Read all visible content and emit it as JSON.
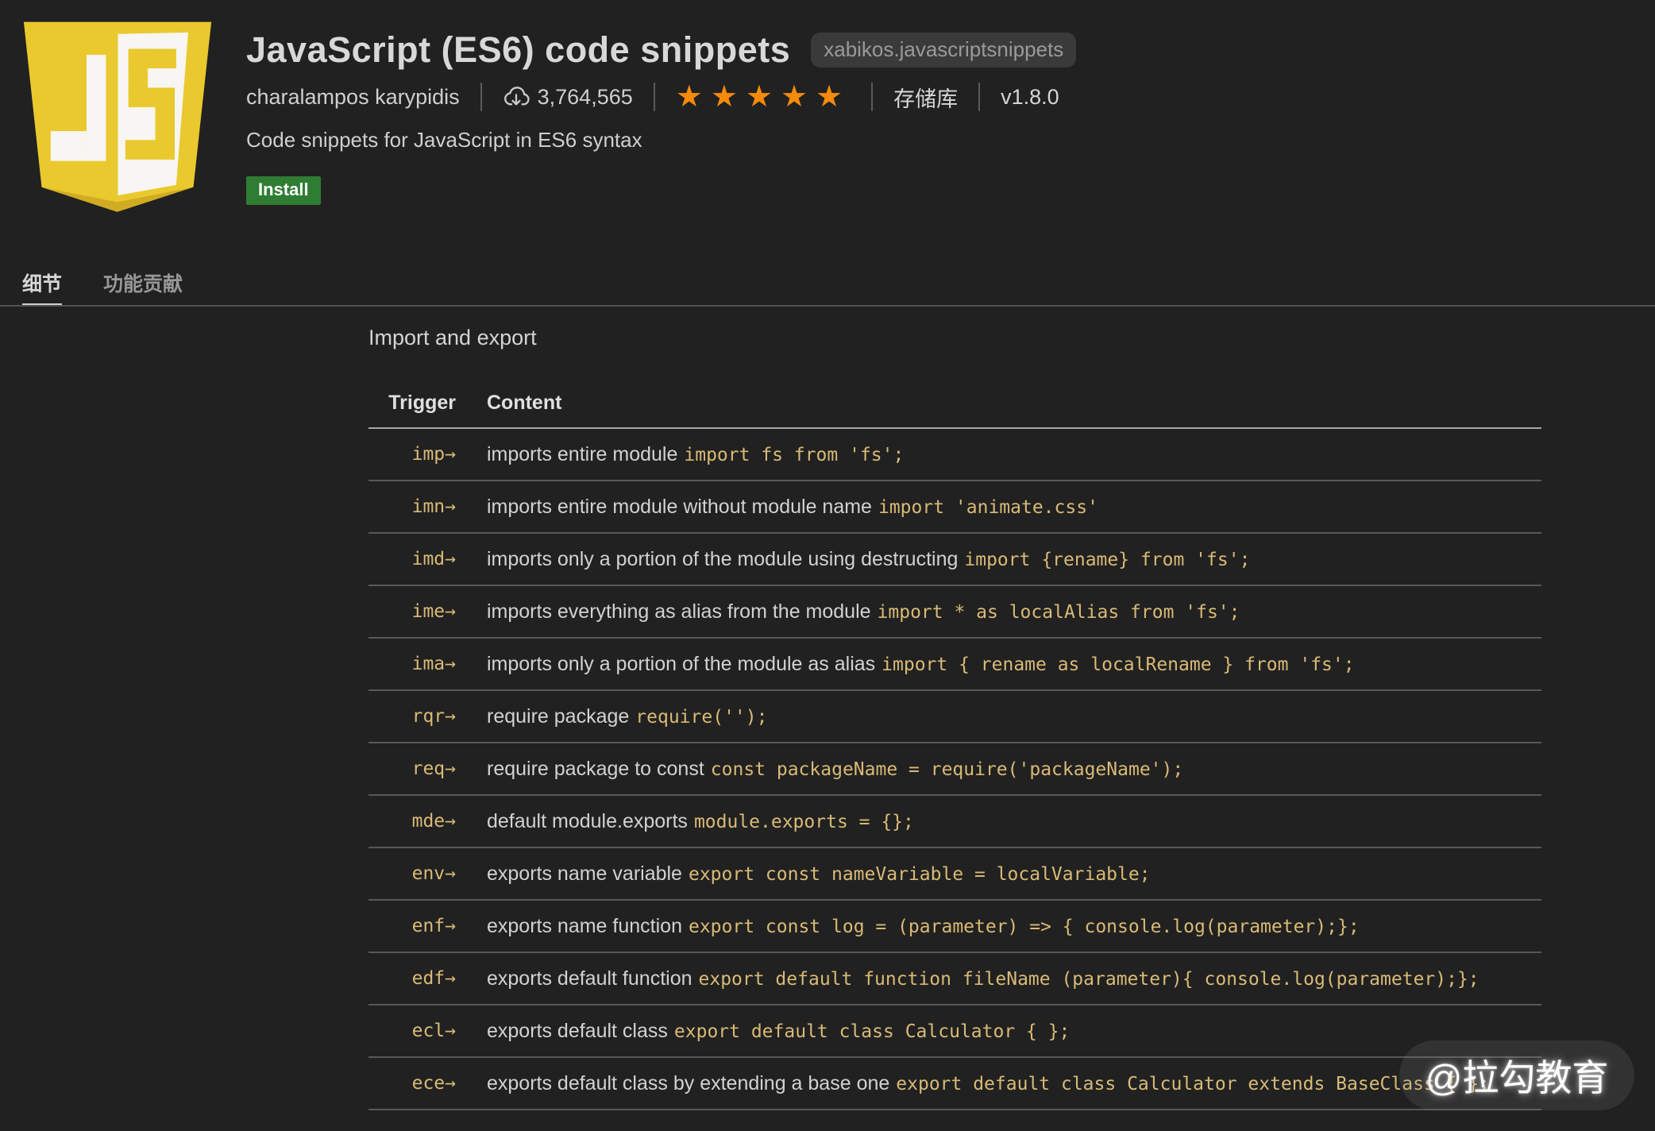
{
  "header": {
    "title": "JavaScript (ES6) code snippets",
    "extension_id": "xabikos.javascriptsnippets",
    "publisher": "charalampos karypidis",
    "downloads": "3,764,565",
    "rating_stars": 5,
    "repository_label": "存储库",
    "version": "v1.8.0",
    "description": "Code snippets for JavaScript in ES6 syntax",
    "install_label": "Install"
  },
  "tabs": [
    {
      "label": "细节",
      "active": true
    },
    {
      "label": "功能贡献",
      "active": false
    }
  ],
  "main": {
    "section_title": "Import and export",
    "table": {
      "columns": [
        "Trigger",
        "Content"
      ],
      "rows": [
        {
          "trigger": "imp→",
          "description": "imports entire module",
          "code": "import fs from 'fs';"
        },
        {
          "trigger": "imn→",
          "description": "imports entire module without module name",
          "code": "import 'animate.css'"
        },
        {
          "trigger": "imd→",
          "description": "imports only a portion of the module using destructing",
          "code": "import {rename} from 'fs';"
        },
        {
          "trigger": "ime→",
          "description": "imports everything as alias from the module",
          "code": "import * as localAlias from 'fs';"
        },
        {
          "trigger": "ima→",
          "description": "imports only a portion of the module as alias",
          "code": "import { rename as localRename } from 'fs';"
        },
        {
          "trigger": "rqr→",
          "description": "require package",
          "code": "require('');"
        },
        {
          "trigger": "req→",
          "description": "require package to const",
          "code": "const packageName = require('packageName');"
        },
        {
          "trigger": "mde→",
          "description": "default module.exports",
          "code": "module.exports = {};"
        },
        {
          "trigger": "env→",
          "description": "exports name variable",
          "code": "export const nameVariable = localVariable;"
        },
        {
          "trigger": "enf→",
          "description": "exports name function",
          "code": "export const log = (parameter) => { console.log(parameter);};"
        },
        {
          "trigger": "edf→",
          "description": "exports default function",
          "code": "export default function fileName (parameter){ console.log(parameter);};"
        },
        {
          "trigger": "ecl→",
          "description": "exports default class",
          "code": "export default class Calculator { };"
        },
        {
          "trigger": "ece→",
          "description": "exports default class by extending a base one",
          "code": "export default class Calculator extends BaseClass { };"
        }
      ]
    }
  },
  "watermark": "@拉勾教育",
  "colors": {
    "background": "#212121",
    "code_accent": "#d9ba76",
    "star_orange": "#f68a0c",
    "install_green": "#2f7d33",
    "logo_yellow": "#e9c92d",
    "divider_row": "#585858",
    "divider_header": "#a8a8a8"
  }
}
